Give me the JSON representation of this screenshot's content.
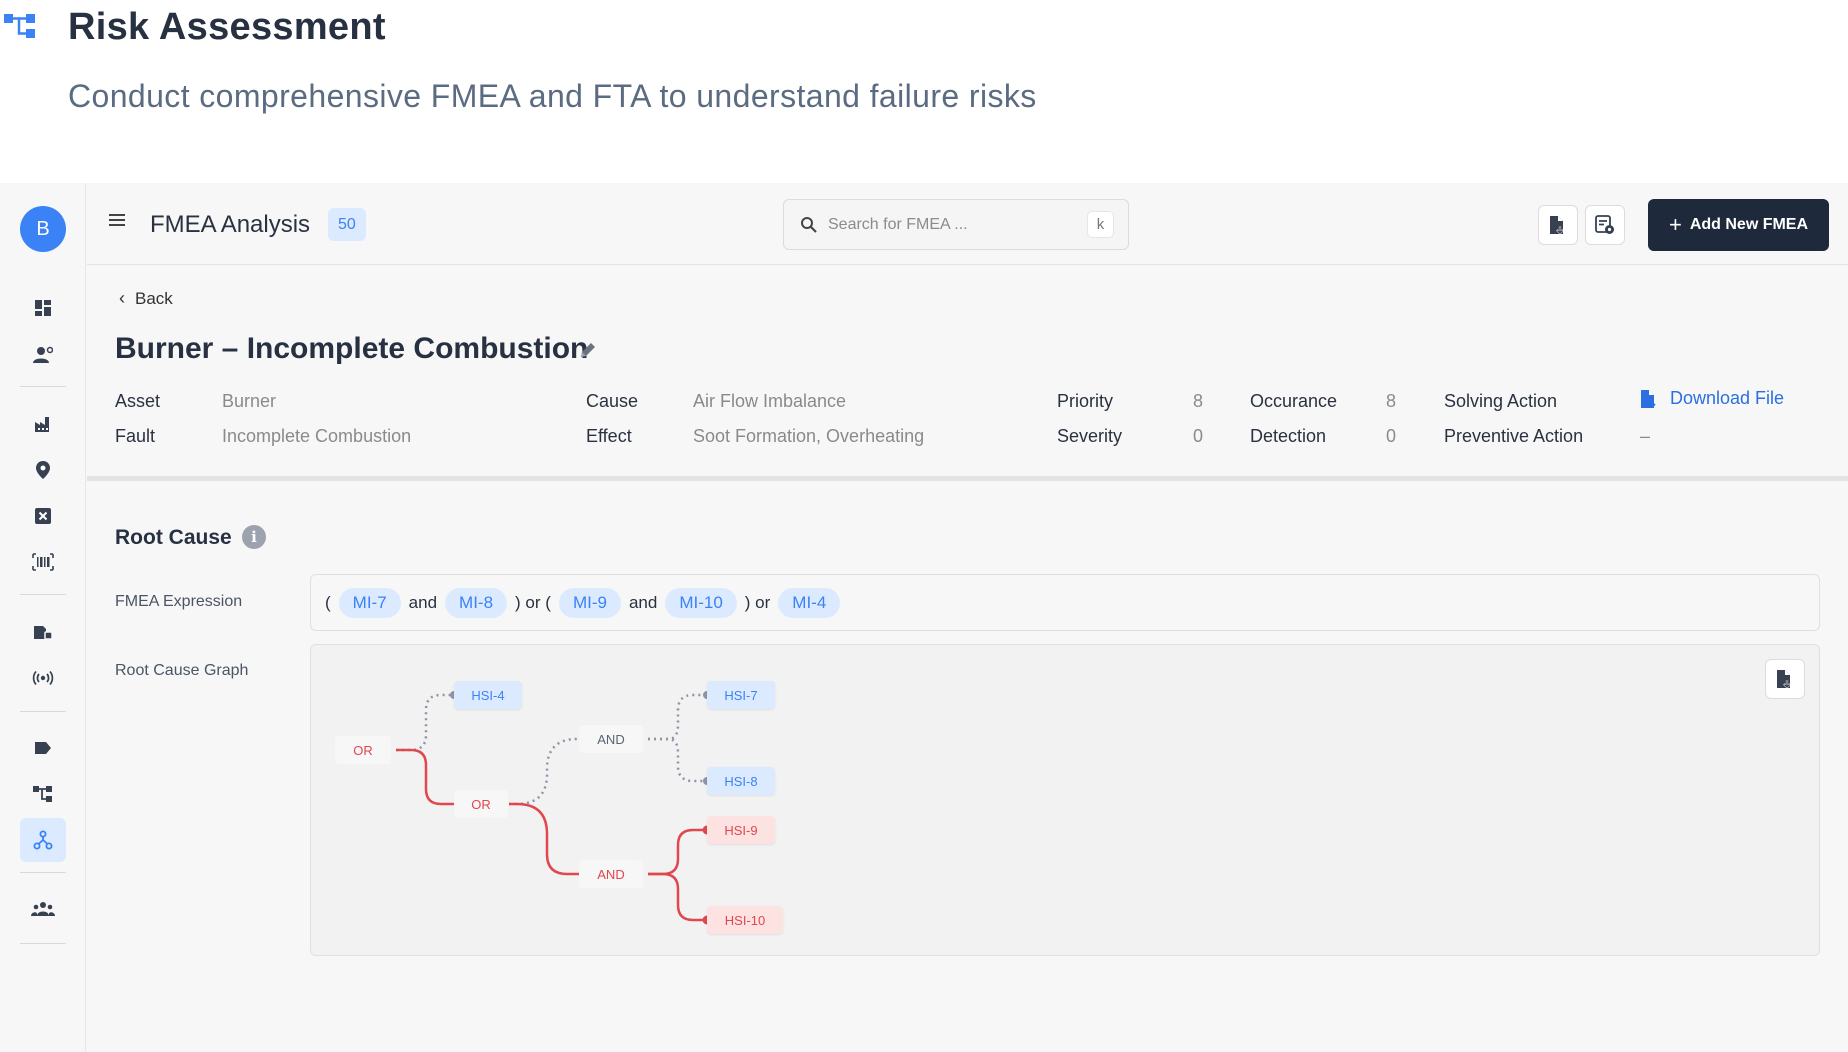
{
  "header": {
    "title": "Risk Assessment",
    "subtitle": "Conduct comprehensive FMEA and FTA to understand failure risks"
  },
  "sidebar": {
    "avatar_initial": "B",
    "items": [
      {
        "icon": "dashboard-icon"
      },
      {
        "icon": "user-settings-icon"
      },
      {
        "icon": "factory-icon"
      },
      {
        "icon": "location-pin-icon"
      },
      {
        "icon": "close-box-icon"
      },
      {
        "icon": "barcode-icon"
      },
      {
        "icon": "asset-tag-icon"
      },
      {
        "icon": "sensor-icon"
      },
      {
        "icon": "label-icon"
      },
      {
        "icon": "hierarchy-icon"
      },
      {
        "icon": "network-icon",
        "active": true
      },
      {
        "icon": "users-icon"
      }
    ]
  },
  "toolbar": {
    "title": "FMEA Analysis",
    "count": "50",
    "search_placeholder": "Search for FMEA ...",
    "search_shortcut": "k",
    "add_label": "Add New FMEA"
  },
  "detail": {
    "back_label": "Back",
    "title": "Burner – Incomplete Combustion",
    "asset_label": "Asset",
    "asset_value": "Burner",
    "fault_label": "Fault",
    "fault_value": "Incomplete Combustion",
    "cause_label": "Cause",
    "cause_value": "Air Flow Imbalance",
    "effect_label": "Effect",
    "effect_value": "Soot Formation, Overheating",
    "priority_label": "Priority",
    "priority_value": "8",
    "severity_label": "Severity",
    "severity_value": "0",
    "occurance_label": "Occurance",
    "occurance_value": "8",
    "detection_label": "Detection",
    "detection_value": "0",
    "solving_label": "Solving Action",
    "solving_link": "Download File",
    "preventive_label": "Preventive Action",
    "preventive_value": "–"
  },
  "root_cause": {
    "title": "Root Cause",
    "expression_label": "FMEA Expression",
    "graph_label": "Root Cause Graph",
    "expression": [
      {
        "t": "tok",
        "v": "("
      },
      {
        "t": "chip",
        "v": "MI-7"
      },
      {
        "t": "tok",
        "v": "and"
      },
      {
        "t": "chip",
        "v": "MI-8"
      },
      {
        "t": "tok",
        "v": ") or ("
      },
      {
        "t": "chip",
        "v": "MI-9"
      },
      {
        "t": "tok",
        "v": "and"
      },
      {
        "t": "chip",
        "v": "MI-10"
      },
      {
        "t": "tok",
        "v": ") or"
      },
      {
        "t": "chip",
        "v": "MI-4"
      }
    ],
    "graph": {
      "root": "OR",
      "or2": "OR",
      "and1": "AND",
      "and2": "AND",
      "hsi4": "HSI-4",
      "hsi7": "HSI-7",
      "hsi8": "HSI-8",
      "hsi9": "HSI-9",
      "hsi10": "HSI-10"
    }
  },
  "colors": {
    "accent": "#3b82f6",
    "dark_button": "#1e293b",
    "highlight_red": "#e0474f",
    "chip_bg": "#dbeafe"
  }
}
